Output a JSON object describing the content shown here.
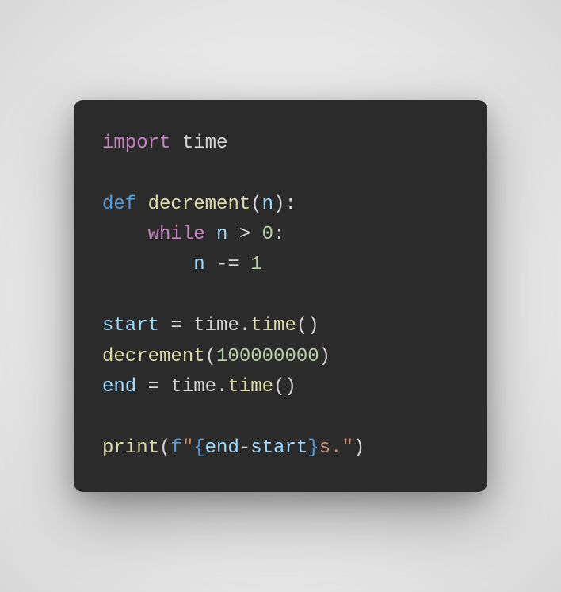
{
  "code": {
    "line1": {
      "import_kw": "import",
      "module": "time"
    },
    "line3": {
      "def_kw": "def",
      "func_name": "decrement",
      "lparen": "(",
      "param": "n",
      "rparen_colon": "):"
    },
    "line4": {
      "while_kw": "while",
      "var": "n",
      "op": ">",
      "num": "0",
      "colon": ":"
    },
    "line5": {
      "var": "n",
      "op": "-=",
      "num": "1"
    },
    "line7": {
      "var": "start",
      "eq": "=",
      "module": "time",
      "dot": ".",
      "func": "time",
      "parens": "()"
    },
    "line8": {
      "func": "decrement",
      "lparen": "(",
      "num": "100000000",
      "rparen": ")"
    },
    "line9": {
      "var": "end",
      "eq": "=",
      "module": "time",
      "dot": ".",
      "func": "time",
      "parens": "()"
    },
    "line11": {
      "func": "print",
      "lparen": "(",
      "fprefix": "f",
      "quote1": "\"",
      "lbrace": "{",
      "expr1": "end",
      "minus": "-",
      "expr2": "start",
      "rbrace": "}",
      "str_tail": "s.",
      "quote2": "\"",
      "rparen": ")"
    }
  }
}
